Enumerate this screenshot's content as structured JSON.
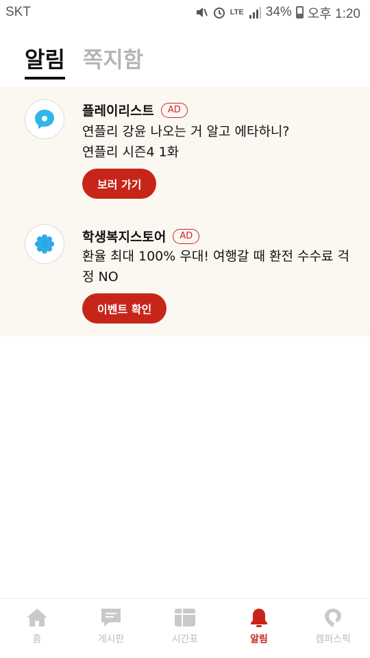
{
  "status_bar": {
    "carrier": "SKT",
    "network": "LTE",
    "battery": "34%",
    "time": "오후 1:20"
  },
  "tabs": [
    {
      "label": "알림",
      "active": true
    },
    {
      "label": "쪽지함",
      "active": false
    }
  ],
  "notifications": [
    {
      "title": "플레이리스트",
      "badge": "AD",
      "body": "연플리 강윤 나오는 거 알고 에타하니?\n연플리 시즌4 1화",
      "button": "보러 가기",
      "icon": "chat-bubble-icon"
    },
    {
      "title": "학생복지스토어",
      "badge": "AD",
      "body": "환율 최대 100% 우대! 여행갈 때 환전 수수료 걱정 NO",
      "button": "이벤트 확인",
      "icon": "flower-icon"
    }
  ],
  "bottom_nav": [
    {
      "label": "홈",
      "icon": "home-icon",
      "active": false
    },
    {
      "label": "게시판",
      "icon": "board-icon",
      "active": false
    },
    {
      "label": "시간표",
      "icon": "timetable-icon",
      "active": false
    },
    {
      "label": "알림",
      "icon": "bell-icon",
      "active": true
    },
    {
      "label": "캠퍼스픽",
      "icon": "campuspick-icon",
      "active": false
    }
  ],
  "colors": {
    "accent": "#c8251a",
    "list_background": "#fbf7f1",
    "inactive": "#bdbdbd"
  }
}
